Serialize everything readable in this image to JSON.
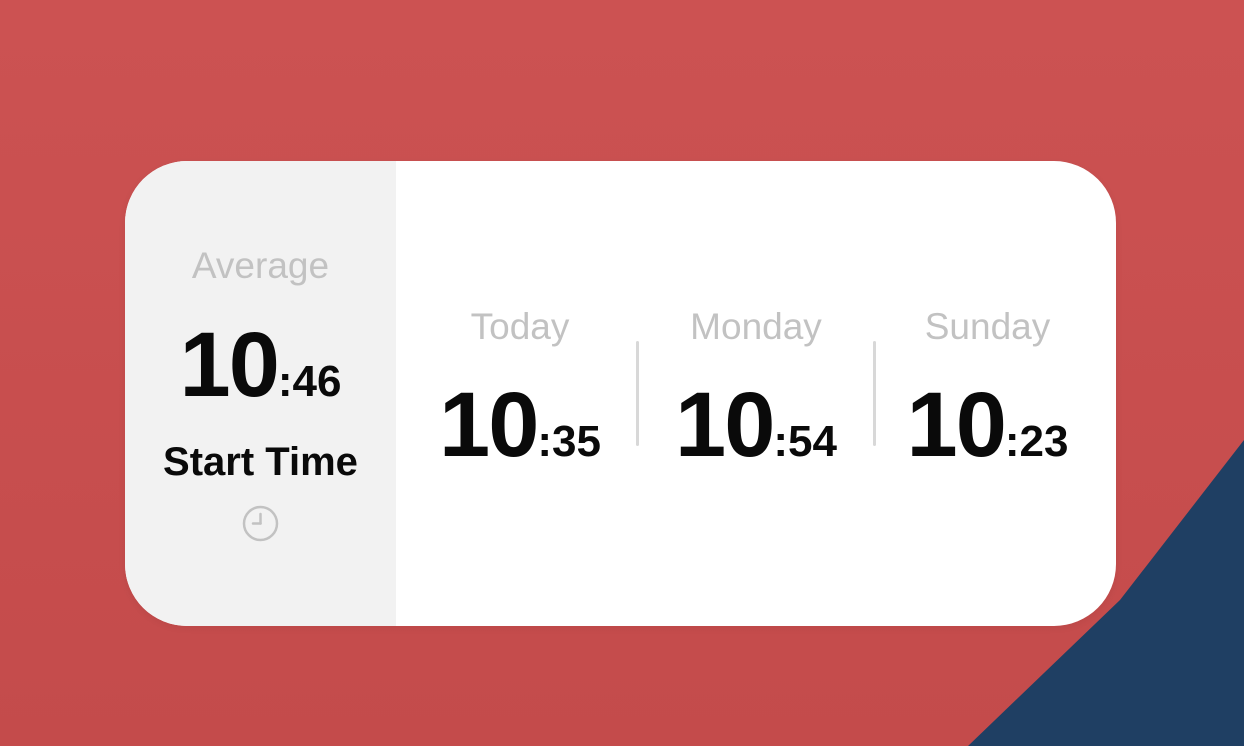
{
  "colors": {
    "wallpaper_red": "#c9504f",
    "wallpaper_blue": "#1f3f63",
    "widget_bg": "#ffffff",
    "average_panel_bg": "#f2f2f2",
    "muted_text": "#c2c2c2",
    "primary_text": "#0a0a0a"
  },
  "widget": {
    "average": {
      "label": "Average",
      "hours": "10",
      "minutes": ":46",
      "caption": "Start Time",
      "icon": "clock-icon"
    },
    "days": [
      {
        "label": "Today",
        "hours": "10",
        "minutes": ":35"
      },
      {
        "label": "Monday",
        "hours": "10",
        "minutes": ":54"
      },
      {
        "label": "Sunday",
        "hours": "10",
        "minutes": ":23"
      }
    ]
  }
}
